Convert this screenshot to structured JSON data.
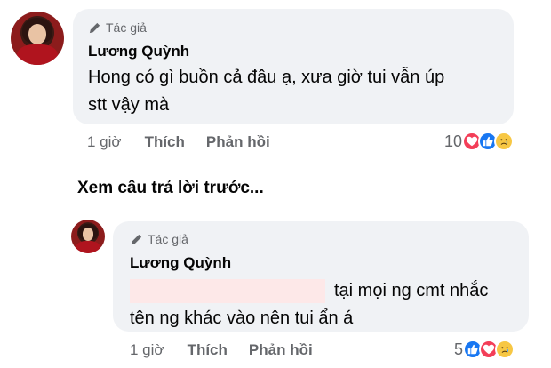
{
  "comments": [
    {
      "author_tag": "Tác giả",
      "author": "Lương Quỳnh",
      "text_lines": [
        "Hong có gì buồn cả đâu ạ, xưa giờ tui vẫn úp",
        "stt vậy mà"
      ],
      "time": "1 giờ",
      "like": "Thích",
      "reply": "Phản hồi",
      "reaction_count": "10"
    },
    {
      "author_tag": "Tác giả",
      "author": "Lương Quỳnh",
      "text_lines": [
        "tại mọi ng cmt nhắc",
        "tên ng khác vào nên tui ẩn á"
      ],
      "time": "1 giờ",
      "like": "Thích",
      "reply": "Phản hồi",
      "reaction_count": "5"
    }
  ],
  "view_previous": "Xem câu trả lời trước...",
  "colors": {
    "bubble": "#f0f2f5",
    "meta": "#65676b",
    "love": "#f33e58",
    "like": "#1877f2",
    "sad": "#f7c744"
  }
}
